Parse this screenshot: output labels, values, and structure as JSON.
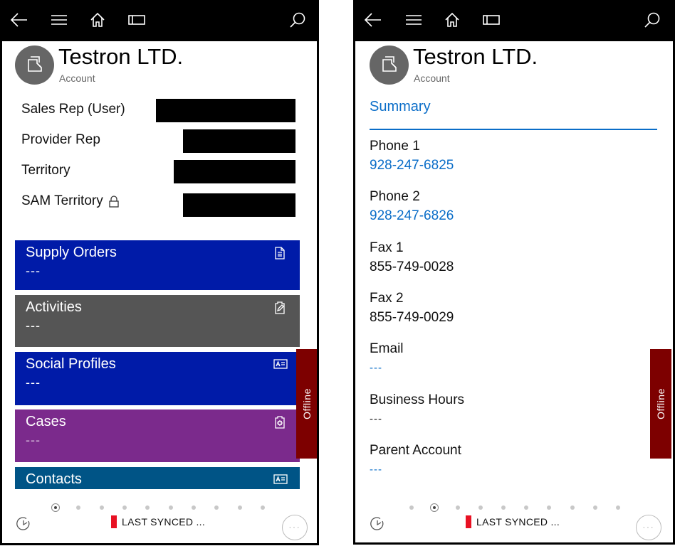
{
  "topbar": {
    "icons": [
      "back-arrow-icon",
      "hamburger-menu-icon",
      "home-icon",
      "panel-toggle-icon",
      "search-icon"
    ]
  },
  "record": {
    "title": "Testron LTD.",
    "entity_type": "Account",
    "avatar_icon": "account-folder-icon"
  },
  "left_panel": {
    "fields": [
      {
        "label": "Sales Rep (User)",
        "value_redacted": true
      },
      {
        "label": "Provider Rep",
        "value_redacted": true
      },
      {
        "label": "Territory",
        "value_redacted": true
      },
      {
        "label": "SAM Territory",
        "locked": true,
        "value_redacted": true
      }
    ],
    "tiles": [
      {
        "label": "Supply Orders",
        "value": "---",
        "icon": "document-list-icon",
        "color": "#001ba8"
      },
      {
        "label": "Activities",
        "value": "---",
        "icon": "clipboard-pencil-icon",
        "color": "#555555"
      },
      {
        "label": "Social Profiles",
        "value": "---",
        "icon": "contact-card-icon",
        "color": "#001ba8"
      },
      {
        "label": "Cases",
        "value": "---",
        "icon": "clipboard-gear-icon",
        "color": "#7b2a8c"
      },
      {
        "label": "Contacts",
        "value": "",
        "icon": "contact-card-icon",
        "color": "#005486"
      }
    ],
    "pager": {
      "total": 10,
      "active_index": 0
    }
  },
  "right_panel": {
    "section_tab": "Summary",
    "fields": [
      {
        "label": "Phone 1",
        "value": "928-247-6825",
        "link": true
      },
      {
        "label": "Phone 2",
        "value": "928-247-6826",
        "link": true
      },
      {
        "label": "Fax 1",
        "value": "855-749-0028",
        "link": false
      },
      {
        "label": "Fax 2",
        "value": "855-749-0029",
        "link": false
      },
      {
        "label": "Email",
        "value": "---",
        "link": true
      },
      {
        "label": "Business Hours",
        "value": "---",
        "link": false
      },
      {
        "label": "Parent Account",
        "value": "---",
        "link": true
      }
    ],
    "pager": {
      "total": 10,
      "active_index": 1
    }
  },
  "status": {
    "offline_label": "Offline",
    "sync_text": "LAST SYNCED ...",
    "sync_indicator_color": "#e81123",
    "more_label": "···"
  },
  "colors": {
    "accent": "#0a6dc8",
    "offline": "#7d0000",
    "avatar": "#666666"
  }
}
